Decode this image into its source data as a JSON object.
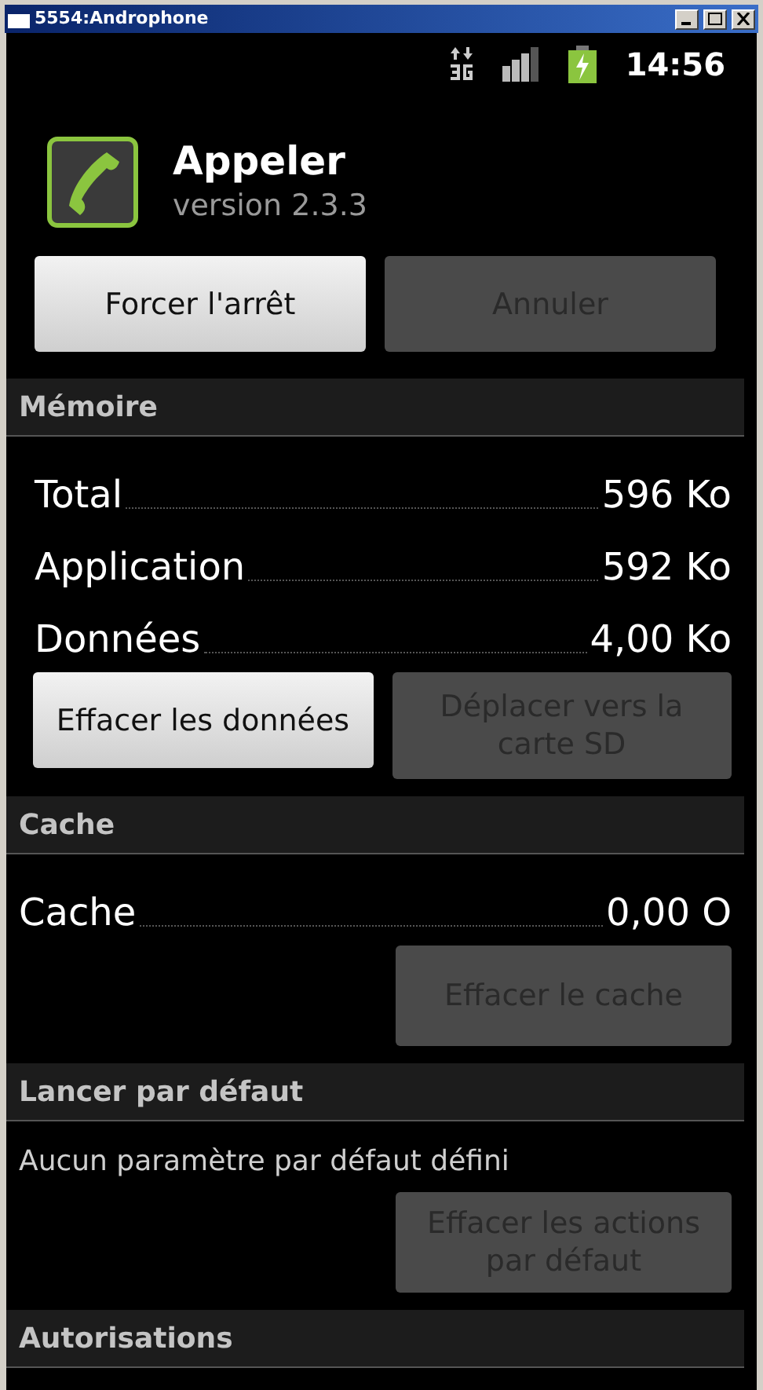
{
  "window": {
    "title": "5554:Androphone"
  },
  "status_bar": {
    "time": "14:56"
  },
  "app": {
    "name": "Appeler",
    "version": "version 2.3.3"
  },
  "top_buttons": [
    {
      "label": "Forcer l'arrêt",
      "disabled": false
    },
    {
      "label": "Annuler",
      "disabled": true
    }
  ],
  "sections": [
    {
      "title": "Mémoire",
      "rows": [
        {
          "label": "Total",
          "value": "596 Ko"
        },
        {
          "label": "Application",
          "value": "592 Ko"
        },
        {
          "label": "Données",
          "value": "4,00 Ko"
        }
      ],
      "buttons": [
        {
          "label": "Effacer les données",
          "disabled": false
        },
        {
          "label": "Déplacer vers la carte SD",
          "disabled": true
        }
      ]
    },
    {
      "title": "Cache",
      "rows": [
        {
          "label": "Cache",
          "value": "0,00 O"
        }
      ],
      "buttons": [
        {
          "label": "Effacer le cache",
          "disabled": true
        }
      ]
    },
    {
      "title": "Lancer par défaut",
      "text": "Aucun paramètre par défaut défini",
      "buttons": [
        {
          "label": "Effacer les actions par défaut",
          "disabled": true
        }
      ]
    },
    {
      "title": "Autorisations"
    }
  ]
}
